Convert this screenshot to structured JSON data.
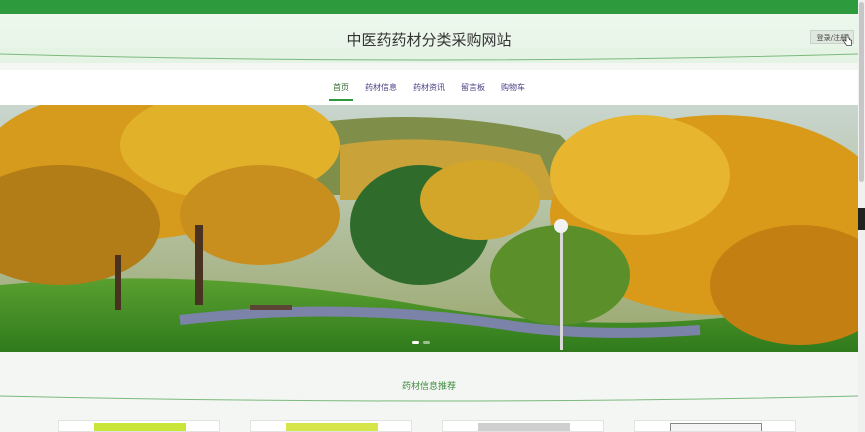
{
  "header": {
    "site_title": "中医药药材分类采购网站",
    "login_label": "登录/注册"
  },
  "nav": {
    "items": [
      {
        "label": "首页",
        "active": true
      },
      {
        "label": "药材信息",
        "active": false
      },
      {
        "label": "药材资讯",
        "active": false
      },
      {
        "label": "留言板",
        "active": false
      },
      {
        "label": "购物车",
        "active": false
      }
    ]
  },
  "banner": {
    "slide_count": 2,
    "active_slide": 1
  },
  "section": {
    "title": "药材信息推荐"
  },
  "colors": {
    "brand_green": "#2e9a3e",
    "nav_text": "#4a3d86"
  }
}
